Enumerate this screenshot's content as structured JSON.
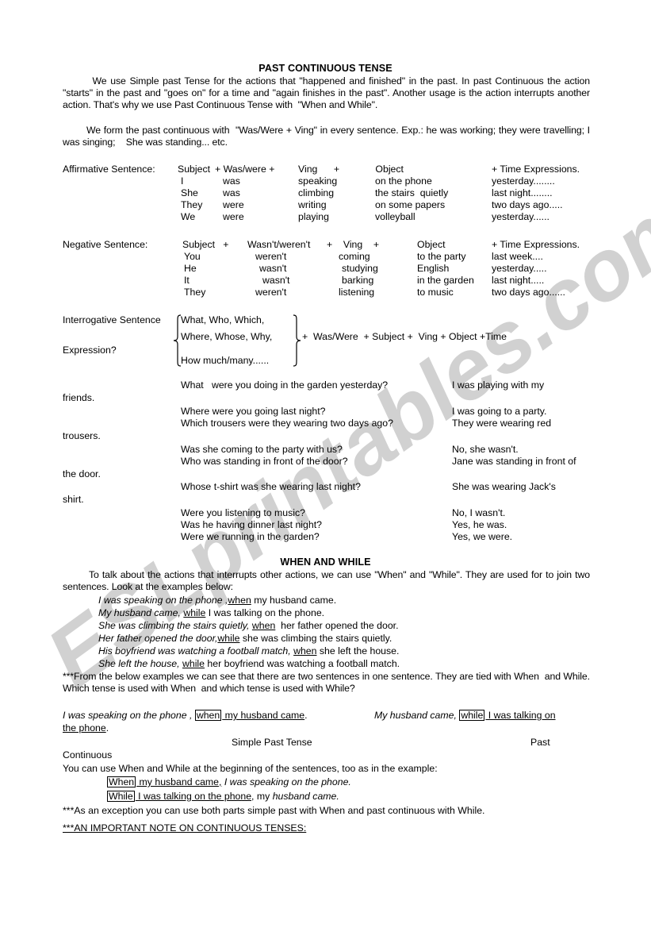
{
  "document": {
    "title": "PAST CONTINUOUS TENSE",
    "watermark": "ESLprintables.com"
  },
  "intro": {
    "paragraph1": "        We use Simple past Tense for the actions that \"happened and finished\" in the past. In past Continuous the action \"starts\" in the past and \"goes on\" for a time and \"again finishes in the past\". Another usage is the action interrupts another action. That's why we use Past Continuous Tense with  \"When and While\".",
    "paragraph2": "        We form the past continuous with  \"Was/Were + Ving\" in every sentence. Exp.: he was working; they were travelling; I was singing;    She was standing... etc."
  },
  "affirmative": {
    "label": "Affirmative Sentence:",
    "header": {
      "subject": "Subject",
      "aux": "+ Was/were +",
      "ving": "Ving      +",
      "object": " Object",
      "time": "+ Time Expressions."
    },
    "rows": [
      {
        "subject": "I",
        "aux": "was",
        "ving": "speaking",
        "object": "on the phone",
        "time": "yesterday........"
      },
      {
        "subject": "She",
        "aux": "was",
        "ving": "climbing",
        "object": "the stairs  quietly",
        "time": "last night........"
      },
      {
        "subject": "They",
        "aux": "were",
        "ving": "writing",
        "object": "on some papers",
        "time": "two days ago....."
      },
      {
        "subject": "We",
        "aux": "were",
        "ving": "playing",
        "object": "volleyball",
        "time": "yesterday......"
      }
    ]
  },
  "negative": {
    "label": "Negative Sentence:",
    "header": {
      "subject": "Subject   +",
      "aux": "Wasn't/weren't",
      "ving": "+    Ving    +",
      "object": "Object",
      "time": "+ Time Expressions."
    },
    "rows": [
      {
        "subject": "You",
        "aux": "weren't",
        "ving": "coming",
        "object": "to the party",
        "time": "last week...."
      },
      {
        "subject": "He",
        "aux": "wasn't",
        "ving": "studying",
        "object": "English",
        "time": "yesterday....."
      },
      {
        "subject": "It",
        "aux": "wasn't",
        "ving": "barking",
        "object": "in the garden",
        "time": "last night....."
      },
      {
        "subject": "They",
        "aux": "weren't",
        "ving": "listening",
        "object": "to music",
        "time": "two days ago......"
      }
    ]
  },
  "interrogative": {
    "label_line1": "Interrogative Sentence",
    "label_line2": "Expression?",
    "brace_items": [
      "What, Who, Which,",
      "Where, Whose, Why,",
      "How much/many......"
    ],
    "formula": "+  Was/Were  + Subject +  Ving + Object +Time"
  },
  "qa": {
    "groups": [
      {
        "pairs": [
          {
            "question": "What   were you doing in the garden yesterday?",
            "answer": "I was playing with my",
            "overflow": "friends."
          }
        ]
      },
      {
        "pairs": [
          {
            "question": "Where were you going last night?",
            "answer": "I was going to a party.",
            "overflow": ""
          },
          {
            "question": "Which trousers were they wearing two days ago?",
            "answer": "They were wearing red",
            "overflow": "trousers."
          }
        ]
      },
      {
        "pairs": [
          {
            "question": "Was she coming to the party with us?",
            "answer": "No, she wasn't.",
            "overflow": ""
          },
          {
            "question": "Who was standing in front of the door?",
            "answer": "Jane was standing in front of",
            "overflow": "the door."
          }
        ]
      },
      {
        "pairs": [
          {
            "question": "Whose t-shirt was she wearing last night?",
            "answer": "She was wearing Jack's",
            "overflow": "shirt."
          }
        ]
      },
      {
        "pairs": [
          {
            "question": "Were you listening to music?",
            "answer": "No, I wasn't.",
            "overflow": ""
          },
          {
            "question": "Was he having dinner last night?",
            "answer": "Yes, he was.",
            "overflow": ""
          },
          {
            "question": "Were we running in the garden?",
            "answer": "Yes, we were.",
            "overflow": ""
          }
        ]
      }
    ]
  },
  "whenwhile": {
    "title": "WHEN AND WHILE",
    "intro": "        To talk about the actions that interrupts other actions, we can use \"When\" and \"While\". They are used for to join two sentences. Look at the examples below:",
    "examples": [
      {
        "italic": "I was speaking on the phone ,",
        "keyword": "when",
        "rest": " my husband came."
      },
      {
        "italic": "My husband came,",
        "keyword": "while",
        "rest": " I was talking on the phone."
      },
      {
        "italic": "She was climbing the stairs quietly,",
        "keyword": "when",
        "rest": "  her father opened the door."
      },
      {
        "italic": "Her father opened the door,",
        "keyword": "while",
        "rest": " she was climbing the stairs quietly."
      },
      {
        "italic": "His boyfriend was watching a football match,",
        "keyword": "when",
        "rest": " she left the house."
      },
      {
        "italic": "She left the house,",
        "keyword": "while",
        "rest": " her boyfriend was watching a football match."
      }
    ],
    "note": "***From the below examples we can see that there are two sentences in one sentence. They are tied with When  and While. Which tense is used with When  and which tense is used with While?"
  },
  "boxed_section": {
    "left": {
      "italic": "I was speaking on the phone ,",
      "boxed": "when",
      "underlined": " my husband came",
      "tail": "."
    },
    "right": {
      "italic": "My husband came,",
      "boxed": "while",
      "underlined": " I was talking on",
      "wrap_underlined": "the phone",
      "tail": "."
    },
    "label_center": "Simple Past Tense",
    "label_right": "Past",
    "label_wrap": "Continuous"
  },
  "beginning_section": {
    "intro": "You can use When and While at the beginning of the sentences, too as in the example:",
    "examples": [
      {
        "boxed": "When",
        "underlined": " my husband came,",
        "italic": " I was speaking on the phone."
      },
      {
        "boxed": "While",
        "underlined": " I was talking on the phone",
        "plain": ", my ",
        "italic": "husband came."
      }
    ],
    "exception": "***As an exception you can use both parts simple past with When and past continuous with While.",
    "important_note": "***AN IMPORTANT NOTE ON CONTINUOUS TENSES:"
  }
}
